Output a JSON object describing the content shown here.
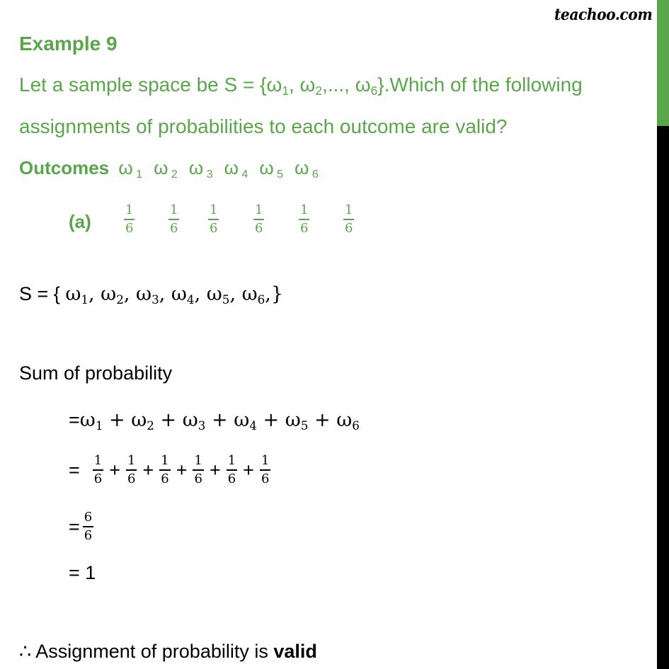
{
  "logo": "teachoo.com",
  "colors": {
    "accent": "#5aa64a",
    "text": "#000000",
    "scrollbar": "#000000"
  },
  "title": "Example 9",
  "question": {
    "line1_prefix": "Let a sample space be S = {",
    "line1_omega1": "ω",
    "line1_sub1": "1",
    "line1_sep1": ", ω",
    "line1_sub2": "2",
    "line1_sep2": ",..., ω",
    "line1_sub6": "6",
    "line1_suffix": "}.Which of the following",
    "line2": "assignments of probabilities to each outcome are valid?"
  },
  "outcomes": {
    "label": "Outcomes",
    "items": [
      {
        "symbol": "ω",
        "sub": "1"
      },
      {
        "symbol": "ω",
        "sub": "2"
      },
      {
        "symbol": "ω",
        "sub": "3"
      },
      {
        "symbol": "ω",
        "sub": "4"
      },
      {
        "symbol": "ω",
        "sub": "5"
      },
      {
        "symbol": "ω",
        "sub": "6"
      }
    ]
  },
  "option_a": {
    "label": "(a)",
    "fractions": [
      {
        "num": "1",
        "den": "6"
      },
      {
        "num": "1",
        "den": "6"
      },
      {
        "num": "1",
        "den": "6"
      },
      {
        "num": "1",
        "den": "6"
      },
      {
        "num": "1",
        "den": "6"
      },
      {
        "num": "1",
        "den": "6"
      }
    ]
  },
  "solution": {
    "s_prefix": "S =  { ",
    "s_items": [
      {
        "symbol": "ω",
        "sub": "1",
        "sep": ", "
      },
      {
        "symbol": "ω",
        "sub": "2",
        "sep": ", "
      },
      {
        "symbol": "ω",
        "sub": "3",
        "sep": ", "
      },
      {
        "symbol": "ω",
        "sub": "4",
        "sep": ", "
      },
      {
        "symbol": "ω",
        "sub": "5",
        "sep": ", "
      },
      {
        "symbol": "ω",
        "sub": "6",
        "sep": ",}"
      }
    ],
    "sum_title": "Sum of probability",
    "step1_eq": "= ",
    "step1_terms": [
      {
        "symbol": "ω",
        "sub": "1",
        "op": " + "
      },
      {
        "symbol": "ω",
        "sub": "2",
        "op": " + "
      },
      {
        "symbol": "ω",
        "sub": "3",
        "op": " + "
      },
      {
        "symbol": "ω",
        "sub": "4",
        "op": " + "
      },
      {
        "symbol": "ω",
        "sub": "5",
        "op": " + "
      },
      {
        "symbol": "ω",
        "sub": "6",
        "op": ""
      }
    ],
    "step2_eq": "=",
    "step2_fracs": [
      {
        "num": "1",
        "den": "6",
        "op": "+"
      },
      {
        "num": "1",
        "den": "6",
        "op": "+"
      },
      {
        "num": "1",
        "den": "6",
        "op": "+"
      },
      {
        "num": "1",
        "den": "6",
        "op": "+"
      },
      {
        "num": "1",
        "den": "6",
        "op": "+"
      },
      {
        "num": "1",
        "den": "6",
        "op": ""
      }
    ],
    "step3_eq": "=",
    "step3_frac": {
      "num": "6",
      "den": "6"
    },
    "step4": "= 1",
    "conclusion_symbol": "∴",
    "conclusion_text": " Assignment of probability is ",
    "conclusion_bold": "valid"
  }
}
